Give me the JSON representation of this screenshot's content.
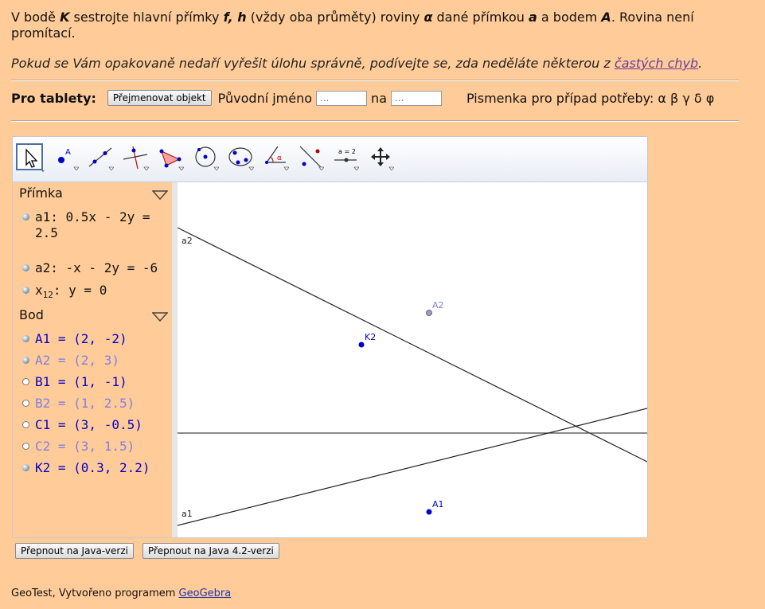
{
  "task": {
    "p1": "V bodě ",
    "K": "K",
    "p2": " sestrojte hlavní přímky ",
    "fh": "f, h",
    "p3": " (vždy oba průměty) roviny ",
    "alpha": "α",
    "p4": " dané přímkou ",
    "a": "a",
    "p5": " a bodem ",
    "A": "A",
    "p6": ". Rovina není promítací."
  },
  "hint": {
    "text": "Pokud se Vám opakovaně nedaří vyřešit úlohu správně, podívejte se, zda neděláte některou z ",
    "link": "častých chyb",
    "end": "."
  },
  "tablet": {
    "label": "Pro tablety:",
    "rename_button": "Přejmenovat objekt",
    "original_name_label": "Původní jméno",
    "original_placeholder": "...",
    "to_label": "na",
    "to_placeholder": "...",
    "letters_label": "Pismenka pro případ potřeby: α β γ δ φ"
  },
  "algebra": {
    "line_section": "Přímka",
    "lines": [
      {
        "text": "a1: 0.5x - 2y = 2.5"
      },
      {
        "text": "a2: -x - 2y = -6"
      },
      {
        "text": "x",
        "sub": "12",
        "rest": ": y = 0"
      }
    ],
    "point_section": "Bod",
    "points": [
      {
        "text": "A1 = (2, -2)"
      },
      {
        "text": "A2 = (2, 3)"
      },
      {
        "text": "B1 = (1, -1)"
      },
      {
        "text": "B2 = (1, 2.5)"
      },
      {
        "text": "C1 = (3, -0.5)"
      },
      {
        "text": "C2 = (3, 1.5)"
      },
      {
        "text": "K2 = (0.3, 2.2)"
      }
    ]
  },
  "graph": {
    "labels": {
      "a2": "a2",
      "a1": "a1",
      "A2": "A2",
      "K2": "K2",
      "A1": "A1"
    }
  },
  "tool_icons": [
    "move-icon",
    "point-icon",
    "line-icon",
    "perpendicular-icon",
    "polygon-icon",
    "circle-icon",
    "conic-icon",
    "angle-icon",
    "reflect-icon",
    "slider-icon",
    "move-view-icon"
  ],
  "buttons": {
    "java": "Přepnout na Java-verzi",
    "java42": "Přepnout na Java 4.2-verzi"
  },
  "footer": {
    "text": "GeoTest, Vytvořeno programem ",
    "link": "GeoGebra"
  },
  "colors": {
    "background": "#ffcc99",
    "point_blue": "#0000cc",
    "point_light": "#7f7fe6"
  }
}
